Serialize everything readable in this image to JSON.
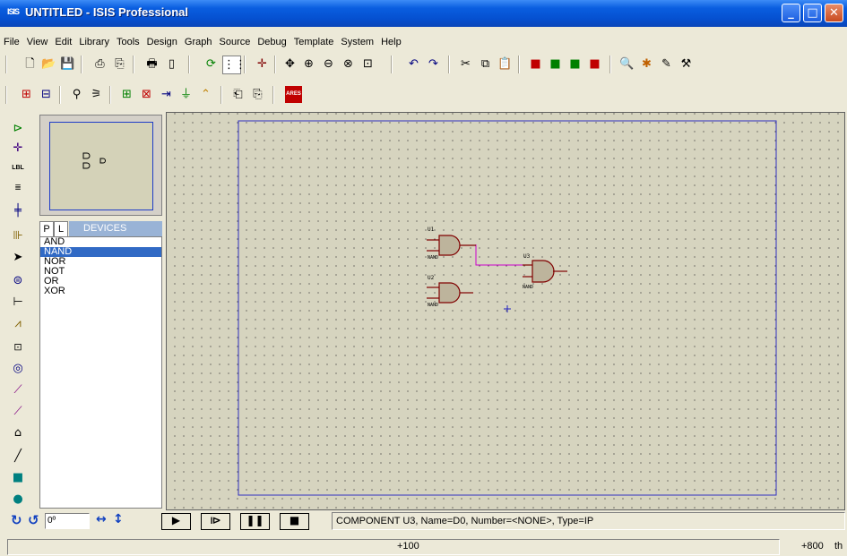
{
  "window": {
    "app_icon": "ISIS",
    "title": "UNTITLED - ISIS Professional",
    "minimize_icon": "minimize-icon",
    "maximize_icon": "maximize-icon",
    "close_icon": "close-icon"
  },
  "menu": [
    "File",
    "View",
    "Edit",
    "Library",
    "Tools",
    "Design",
    "Graph",
    "Source",
    "Debug",
    "Template",
    "System",
    "Help"
  ],
  "toolbar_icons": [
    "new-file-icon",
    "open-folder-icon",
    "save-icon",
    "import-icon",
    "export-icon",
    "print-icon",
    "print-area-icon",
    "refresh-icon",
    "grid-icon",
    "origin-icon",
    "pan-icon",
    "zoom-in-icon",
    "zoom-out-icon",
    "zoom-all-icon",
    "zoom-area-icon",
    "undo-icon",
    "redo-icon",
    "cut-icon",
    "copy-icon",
    "paste-icon",
    "block-copy-icon",
    "block-move-icon",
    "block-rotate-icon",
    "block-delete-icon",
    "pick-device-icon",
    "make-device-icon",
    "packaging-icon",
    "decompose-icon"
  ],
  "toolbar2_icons": [
    "wire-autorouter-icon",
    "search-tag-icon",
    "property-assign-icon",
    "design-explorer-icon",
    "new-sheet-icon",
    "remove-sheet-icon",
    "goto-sheet-icon",
    "bill-of-materials-icon",
    "electrical-check-icon",
    "netlist-icon",
    "netlist-to-ares-icon",
    "ares-icon"
  ],
  "ares_label": "ARES",
  "left_tools": [
    "component-mode-icon",
    "junction-icon",
    "wire-label-icon",
    "text-script-icon",
    "bus-icon",
    "subcircuit-icon",
    "selection-icon",
    "terminal-icon",
    "device-pin-icon",
    "graph-icon",
    "tape-recorder-icon",
    "generator-icon",
    "voltage-probe-icon",
    "current-probe-icon",
    "virtual-instrument-icon",
    "line-icon",
    "box-icon",
    "circle-icon"
  ],
  "left_tool_labels": {
    "wire_label": "LBL",
    "tape": "⊡"
  },
  "devices": {
    "tab_p": "P",
    "tab_l": "L",
    "header": "DEVICES",
    "items": [
      "AND",
      "NAND",
      "NOR",
      "NOT",
      "OR",
      "XOR"
    ],
    "selected": "NAND"
  },
  "overview": {
    "label": "ᴅ ⊃\nᴅ"
  },
  "schematic": {
    "gates": [
      {
        "ref": "U1",
        "part": "NAND"
      },
      {
        "ref": "U2",
        "part": "NAND"
      },
      {
        "ref": "U3",
        "part": "NAND"
      }
    ],
    "wire_color": "#cc00cc",
    "border_color": "#3030c0"
  },
  "bottom": {
    "rotation_value": "0º",
    "play_button": "▶",
    "step_button": "⧐",
    "pause_button": "❚❚",
    "stop_button": "■",
    "message": "COMPONENT U3, Name=D0, Number=<NONE>, Type=IP"
  },
  "status": {
    "coord_x": "+100",
    "coord_y": "+800",
    "units": "th"
  }
}
